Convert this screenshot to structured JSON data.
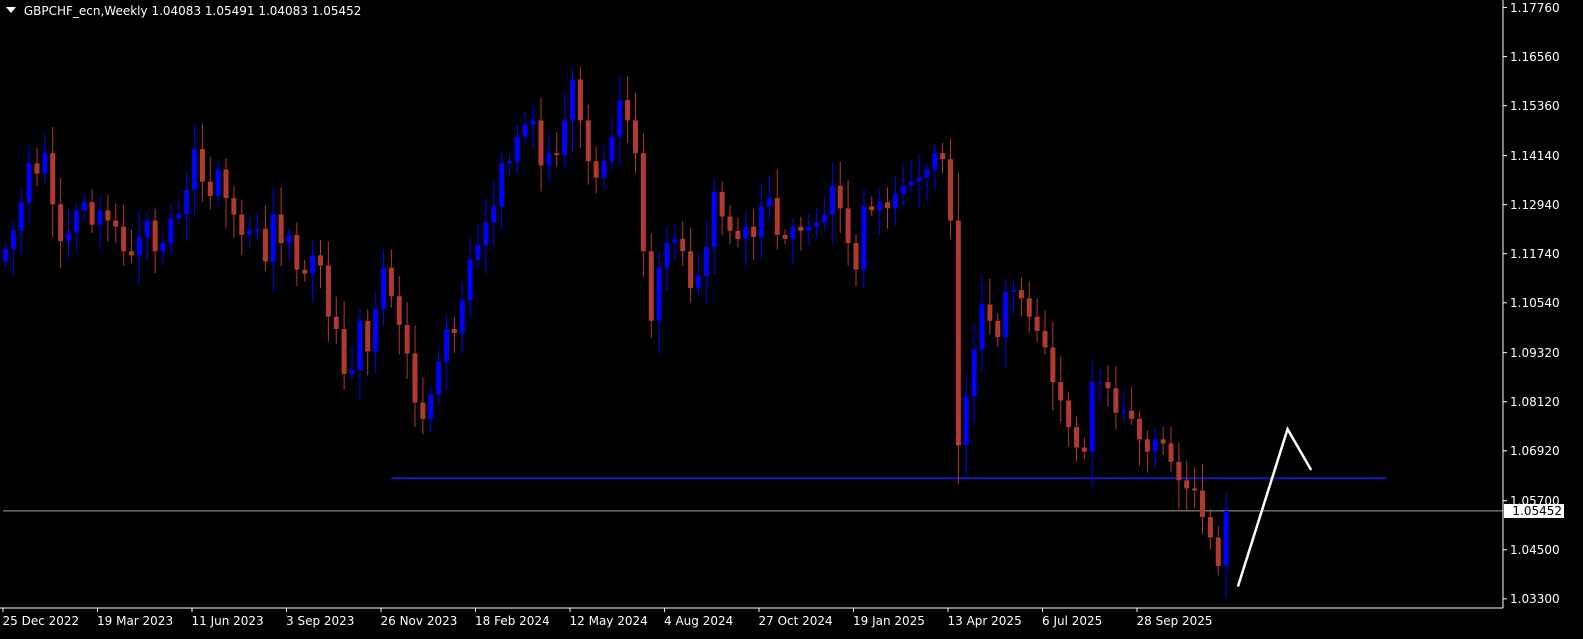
{
  "header": {
    "symbol": "GBPCHF_ecn,Weekly",
    "ohlc": "1.04083 1.05491 1.04083 1.05452"
  },
  "current_price_label": "1.05452",
  "colors": {
    "background": "#000000",
    "bull_candle": "#0000FF",
    "bear_candle": "#B03A2E",
    "support_line": "#1A1AB8",
    "current_price_line": "#A0A0A0",
    "projection": "#FFFFFF",
    "axis": "#FFFFFF"
  },
  "chart_data": {
    "type": "candlestick",
    "title": "GBPCHF_ecn,Weekly",
    "y_ticks": [
      "1.17760",
      "1.16560",
      "1.15360",
      "1.14140",
      "1.12940",
      "1.11740",
      "1.10540",
      "1.09320",
      "1.08120",
      "1.06920",
      "1.05700",
      "1.04500",
      "1.03300"
    ],
    "ylim": [
      1.031,
      1.1792
    ],
    "x_labels": [
      "25 Dec 2022",
      "19 Mar 2023",
      "11 Jun 2023",
      "3 Sep 2023",
      "26 Nov 2023",
      "18 Feb 2024",
      "12 May 2024",
      "4 Aug 2024",
      "27 Oct 2024",
      "19 Jan 2025",
      "13 Apr 2025",
      "6 Jul 2025",
      "28 Sep 2025"
    ],
    "x_label_bar_index": [
      0,
      12,
      24,
      36,
      48,
      60,
      72,
      84,
      96,
      108,
      120,
      132,
      144
    ],
    "bar_count": 157,
    "closes": [
      1.1185,
      1.123,
      1.13,
      1.1395,
      1.137,
      1.142,
      1.1295,
      1.1205,
      1.1225,
      1.128,
      1.13,
      1.1245,
      1.128,
      1.1255,
      1.124,
      1.118,
      1.117,
      1.1215,
      1.1255,
      1.118,
      1.12,
      1.126,
      1.127,
      1.133,
      1.143,
      1.135,
      1.1315,
      1.138,
      1.131,
      1.127,
      1.122,
      1.123,
      1.1235,
      1.1155,
      1.127,
      1.12,
      1.122,
      1.1135,
      1.1125,
      1.117,
      1.1145,
      1.102,
      1.099,
      1.088,
      1.089,
      1.101,
      1.0935,
      1.104,
      1.114,
      1.107,
      1.1,
      1.093,
      1.081,
      1.077,
      1.083,
      1.091,
      1.099,
      1.098,
      1.106,
      1.116,
      1.1195,
      1.125,
      1.129,
      1.1395,
      1.14,
      1.146,
      1.149,
      1.15,
      1.139,
      1.142,
      1.1415,
      1.15,
      1.16,
      1.15,
      1.14,
      1.136,
      1.14,
      1.146,
      1.155,
      1.15,
      1.142,
      1.118,
      1.101,
      1.114,
      1.12,
      1.121,
      1.118,
      1.109,
      1.112,
      1.119,
      1.1325,
      1.1265,
      1.123,
      1.121,
      1.124,
      1.1215,
      1.129,
      1.131,
      1.122,
      1.121,
      1.124,
      1.123,
      1.124,
      1.125,
      1.127,
      1.134,
      1.1285,
      1.12,
      1.1135,
      1.129,
      1.128,
      1.13,
      1.1285,
      1.132,
      1.134,
      1.135,
      1.136,
      1.138,
      1.142,
      1.1405,
      1.1255,
      1.0705,
      1.0825,
      1.094,
      1.105,
      1.101,
      1.097,
      1.108,
      1.1085,
      1.1065,
      1.102,
      1.0985,
      1.0945,
      1.086,
      1.0815,
      1.075,
      1.07,
      1.069,
      1.086,
      1.086,
      1.0845,
      1.0785,
      1.079,
      1.077,
      1.072,
      1.069,
      1.072,
      1.071,
      1.0665,
      1.062,
      1.06,
      1.0595,
      1.053,
      1.048,
      1.041,
      1.0545
    ],
    "support_level": 1.0625,
    "support_start_bar": 49,
    "current_price": 1.05452,
    "projection": {
      "start": {
        "bar": 156.5,
        "price": 1.036
      },
      "peak": {
        "bar": 162.8,
        "price": 1.0745
      },
      "end": {
        "bar": 165.8,
        "price": 1.0645
      }
    },
    "grid": false,
    "legend": "none"
  }
}
